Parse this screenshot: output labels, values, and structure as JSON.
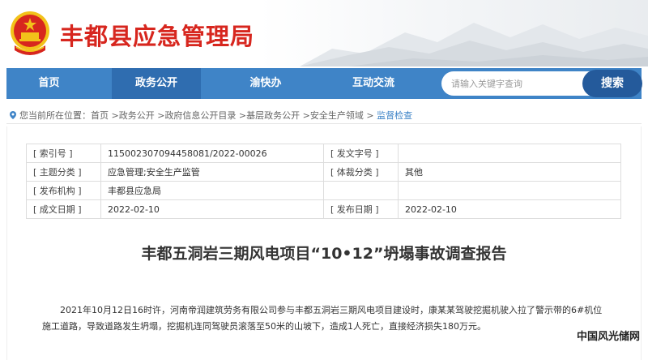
{
  "header": {
    "site_title": "丰都县应急管理局",
    "title_color": "#d7261e",
    "logo_icon": "national-emblem"
  },
  "nav": {
    "items": [
      {
        "label": "首页"
      },
      {
        "label": "政务公开"
      },
      {
        "label": "渝快办"
      },
      {
        "label": "互动交流"
      }
    ],
    "active_index": 1,
    "bar_color": "#3f84c7",
    "active_color": "#2f6db0"
  },
  "search": {
    "placeholder": "请输入关键字查询",
    "button_label": "搜索"
  },
  "breadcrumb": {
    "prefix": "您当前所在位置：",
    "items": [
      "首页",
      "政务公开",
      "政府信息公开目录",
      "基层政务公开",
      "安全生产领域",
      "监督检查"
    ],
    "separator": " >"
  },
  "meta": {
    "rows": [
      {
        "k1": "[ 索引号 ]",
        "v1": "115002307094458081/2022-00026",
        "k2": "[ 发文字号 ]",
        "v2": ""
      },
      {
        "k1": "[ 主题分类 ]",
        "v1": "应急管理;安全生产监管",
        "k2": "[ 体裁分类 ]",
        "v2": "其他"
      },
      {
        "k1": "[ 发布机构 ]",
        "v1": "丰都县应急局",
        "k2": "",
        "v2": ""
      },
      {
        "k1": "[ 成文日期 ]",
        "v1": "2022-02-10",
        "k2": "[ 发布日期 ]",
        "v2": "2022-02-10"
      }
    ]
  },
  "article": {
    "title": "丰都五洞岩三期风电项目“10•12”坍塌事故调查报告",
    "paragraph": "2021年10月12日16时许，河南帝润建筑劳务有限公司参与丰都五洞岩三期风电项目建设时，康某某驾驶挖掘机驶入拉了警示带的6#机位施工道路，导致道路发生坍塌，挖掘机连同驾驶员滚落至50米的山坡下，造成1人死亡，直接经济损失180万元。"
  },
  "watermark": {
    "text": "中国风光储网"
  }
}
